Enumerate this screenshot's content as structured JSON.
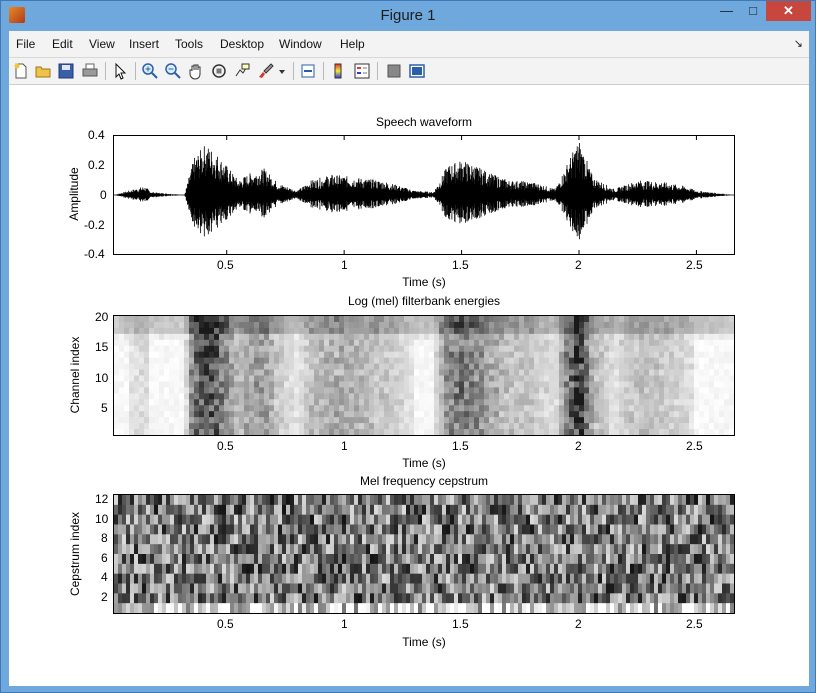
{
  "window": {
    "title": "Figure 1"
  },
  "menu": [
    "File",
    "Edit",
    "View",
    "Insert",
    "Tools",
    "Desktop",
    "Window",
    "Help"
  ],
  "toolbar": [
    "new-figure-icon",
    "open-file-icon",
    "save-icon",
    "print-icon",
    "pointer-icon",
    "zoom-in-icon",
    "zoom-out-icon",
    "pan-hand-icon",
    "rotate-3d-icon",
    "data-cursor-icon",
    "brush-icon",
    "dropdown-arrow-icon",
    "link-plot-icon",
    "colorbar-icon",
    "legend-icon",
    "hide-plot-tools-icon",
    "show-plot-tools-icon"
  ],
  "plots": [
    {
      "title": "Speech waveform",
      "xlabel": "Time (s)",
      "ylabel": "Amplitude",
      "xticks": [
        "0.5",
        "1",
        "1.5",
        "2",
        "2.5"
      ],
      "yticks": [
        "0.4",
        "0.2",
        "0",
        "-0.2",
        "-0.4"
      ]
    },
    {
      "title": "Log (mel) filterbank energies",
      "xlabel": "Time (s)",
      "ylabel": "Channel index",
      "xticks": [
        "0.5",
        "1",
        "1.5",
        "2",
        "2.5"
      ],
      "yticks": [
        "20",
        "15",
        "10",
        "5"
      ]
    },
    {
      "title": "Mel frequency cepstrum",
      "xlabel": "Time (s)",
      "ylabel": "Cepstrum index",
      "xticks": [
        "0.5",
        "1",
        "1.5",
        "2",
        "2.5"
      ],
      "yticks": [
        "12",
        "10",
        "8",
        "6",
        "4",
        "2"
      ]
    }
  ],
  "chart_data": [
    {
      "type": "line",
      "title": "Speech waveform",
      "xlabel": "Time (s)",
      "ylabel": "Amplitude",
      "xlim": [
        0.02,
        2.66
      ],
      "ylim": [
        -0.4,
        0.4
      ],
      "envelope": {
        "x": [
          0.02,
          0.15,
          0.18,
          0.32,
          0.36,
          0.41,
          0.46,
          0.5,
          0.55,
          0.6,
          0.66,
          0.72,
          0.8,
          0.86,
          0.95,
          1.05,
          1.15,
          1.2,
          1.3,
          1.38,
          1.44,
          1.5,
          1.56,
          1.62,
          1.7,
          1.8,
          1.9,
          1.96,
          2.0,
          2.06,
          2.15,
          2.25,
          2.35,
          2.45,
          2.5,
          2.66
        ],
        "y": [
          0.0,
          0.06,
          0.02,
          0.0,
          0.25,
          0.35,
          0.28,
          0.2,
          0.1,
          0.15,
          0.18,
          0.08,
          0.03,
          0.1,
          0.14,
          0.12,
          0.1,
          0.08,
          0.03,
          0.02,
          0.2,
          0.24,
          0.2,
          0.15,
          0.1,
          0.09,
          0.04,
          0.25,
          0.38,
          0.12,
          0.04,
          0.1,
          0.09,
          0.06,
          0.03,
          0.0
        ]
      }
    },
    {
      "type": "heatmap",
      "title": "Log (mel) filterbank energies",
      "xlabel": "Time (s)",
      "ylabel": "Channel index",
      "xlim": [
        0.02,
        2.66
      ],
      "ylim": [
        0.5,
        20.5
      ],
      "colormap": "gray (dark = high energy)"
    },
    {
      "type": "heatmap",
      "title": "Mel frequency cepstrum",
      "xlabel": "Time (s)",
      "ylabel": "Cepstrum index",
      "xlim": [
        0.02,
        2.66
      ],
      "ylim": [
        0.5,
        12.5
      ],
      "colormap": "gray"
    }
  ]
}
